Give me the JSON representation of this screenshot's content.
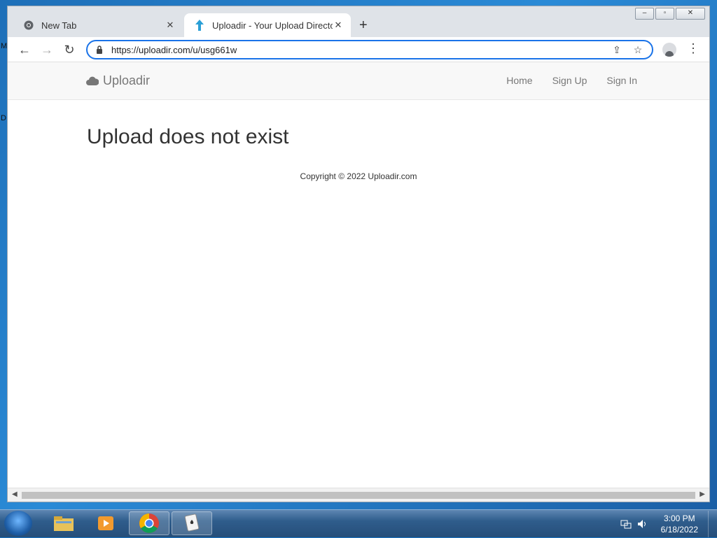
{
  "desktop": {
    "edge_top": "M",
    "edge_mid": "D"
  },
  "browser": {
    "tabs": [
      {
        "label": "New Tab",
        "icon": "chrome-icon",
        "active": false
      },
      {
        "label": "Uploadir - Your Upload Directory",
        "icon": "uploadir-favicon",
        "active": true
      }
    ],
    "address": {
      "url": "https://uploadir.com/u/usg661w"
    }
  },
  "site": {
    "brand": "Uploadir",
    "nav": {
      "home": "Home",
      "signup": "Sign Up",
      "signin": "Sign In"
    },
    "heading": "Upload does not exist",
    "copyright": "Copyright © 2022 Uploadir.com"
  },
  "taskbar": {
    "clock_time": "3:00 PM",
    "clock_date": "6/18/2022"
  },
  "colors": {
    "accent": "#1a73e8",
    "taskbar": "#2f5d8c"
  }
}
